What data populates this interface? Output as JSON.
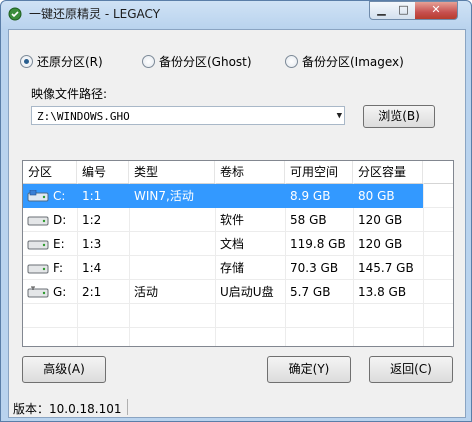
{
  "window": {
    "title": "一键还原精灵 - LEGACY"
  },
  "modes": [
    {
      "label": "还原分区(R)",
      "selected": true
    },
    {
      "label": "备份分区(Ghost)",
      "selected": false
    },
    {
      "label": "备份分区(Imagex)",
      "selected": false
    }
  ],
  "image_path": {
    "label": "映像文件路径:",
    "value": "Z:\\WINDOWS.GHO",
    "browse_label": "浏览(B)"
  },
  "table": {
    "headers": [
      "分区",
      "编号",
      "类型",
      "卷标",
      "可用空间",
      "分区容量"
    ],
    "rows": [
      {
        "drive": "C:",
        "num": "1:1",
        "type": "WIN7,活动",
        "label": "",
        "free": "8.9 GB",
        "size": "80 GB",
        "icon": "system-drive-icon"
      },
      {
        "drive": "D:",
        "num": "1:2",
        "type": "",
        "label": "软件",
        "free": "58 GB",
        "size": "120 GB",
        "icon": "drive-icon"
      },
      {
        "drive": "E:",
        "num": "1:3",
        "type": "",
        "label": "文档",
        "free": "119.8 GB",
        "size": "120 GB",
        "icon": "drive-icon"
      },
      {
        "drive": "F:",
        "num": "1:4",
        "type": "",
        "label": "存储",
        "free": "70.3 GB",
        "size": "145.7 GB",
        "icon": "drive-icon"
      },
      {
        "drive": "G:",
        "num": "2:1",
        "type": "活动",
        "label": "U启动U盘",
        "free": "5.7 GB",
        "size": "13.8 GB",
        "icon": "usb-drive-icon"
      }
    ]
  },
  "buttons": {
    "advanced": "高级(A)",
    "ok": "确定(Y)",
    "back": "返回(C)"
  },
  "status": {
    "version": "版本：10.0.18.101"
  },
  "colors": {
    "selection": "#3399ff",
    "title_bg": "#b9d3ee",
    "close_button": "#c75050"
  }
}
